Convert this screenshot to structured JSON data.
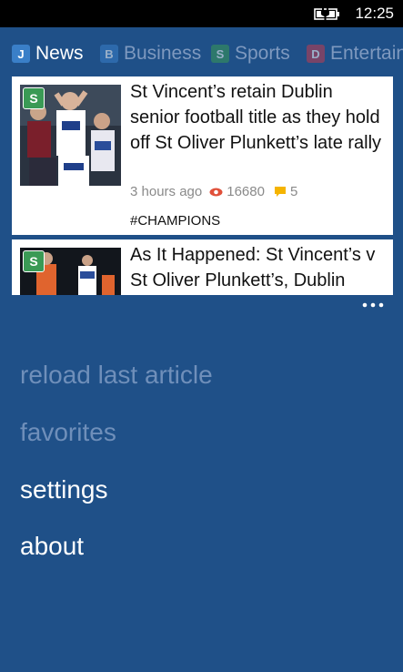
{
  "status_bar": {
    "time": "12:25",
    "battery_icon": "battery-charging-icon"
  },
  "tabs": [
    {
      "badge": "J",
      "label": "News",
      "badge_color": "#3a7fc8",
      "active": true
    },
    {
      "badge": "B",
      "label": "Business",
      "badge_color": "#3a7fc8",
      "active": false
    },
    {
      "badge": "S",
      "label": "Sports",
      "badge_color": "#3a9a55",
      "active": false
    },
    {
      "badge": "D",
      "label": "Entertain",
      "badge_color": "#c23b4f",
      "active": false
    }
  ],
  "articles": [
    {
      "category_badge": "S",
      "title": "St Vincent’s retain Dublin senior football title as they hold off St Oliver Plunkett’s late rally",
      "time_ago": "3 hours ago",
      "views": "16680",
      "comments": "5",
      "tag": "#CHAMPIONS"
    },
    {
      "category_badge": "S",
      "title": "As It Happened: St Vincent’s v St Oliver Plunkett’s, Dublin"
    }
  ],
  "menu": [
    {
      "label": "reload last article",
      "enabled": false
    },
    {
      "label": "favorites",
      "enabled": false
    },
    {
      "label": "settings",
      "enabled": true
    },
    {
      "label": "about",
      "enabled": true
    }
  ],
  "colors": {
    "background": "#1f5088",
    "accent_views": "#e0503a",
    "accent_comments": "#f5b400"
  }
}
